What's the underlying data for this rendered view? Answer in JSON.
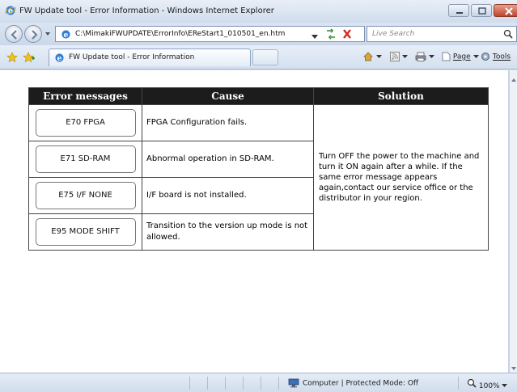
{
  "window": {
    "title": "FW Update tool - Error Information - Windows Internet Explorer"
  },
  "address_bar": {
    "url": "C:\\MimakiFWUPDATE\\ErrorInfo\\EReStart1_010501_en.htm"
  },
  "search": {
    "placeholder": "Live Search"
  },
  "tab": {
    "label": "FW Update tool - Error Information"
  },
  "command_bar": {
    "page_label": "Page",
    "tools_label": "Tools"
  },
  "error_table": {
    "headers": {
      "messages": "Error messages",
      "cause": "Cause",
      "solution": "Solution"
    },
    "rows": [
      {
        "message": "E70 FPGA",
        "cause": "FPGA Configuration fails."
      },
      {
        "message": "E71 SD-RAM",
        "cause": "Abnormal operation in SD-RAM."
      },
      {
        "message": "E75 I/F NONE",
        "cause": "I/F board is not installed."
      },
      {
        "message": "E95 MODE SHIFT",
        "cause": "Transition to the version up mode is not allowed."
      }
    ],
    "solution": "Turn OFF the power to the machine and turn it ON again after a while. If the same error message appears again,contact our service office or the distributor in your region."
  },
  "status_bar": {
    "zone": "Computer | Protected Mode: Off",
    "zoom": "100%"
  },
  "colors": {
    "header_bg": "#1c1c1c",
    "header_text": "#ffffff",
    "chrome": "#dbe5f2"
  }
}
